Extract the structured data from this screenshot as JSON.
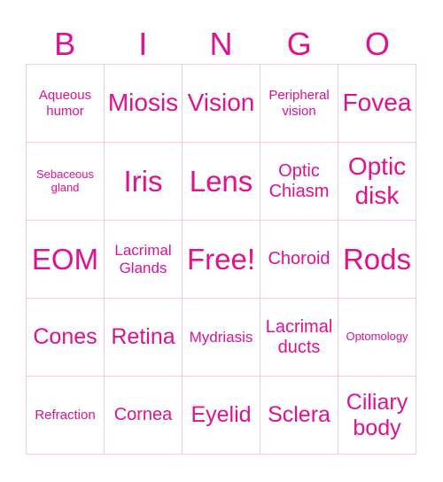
{
  "card": {
    "header": [
      "B",
      "I",
      "N",
      "G",
      "O"
    ],
    "colors": {
      "text": "#e0118f",
      "grid": "#f7c8e3",
      "background": "#ffffff"
    },
    "cells": [
      [
        "Aqueous humor",
        "Miosis",
        "Vision",
        "Peripheral vision",
        "Fovea"
      ],
      [
        "Sebaceous gland",
        "Iris",
        "Lens",
        "Optic Chiasm",
        "Optic disk"
      ],
      [
        "EOM",
        "Lacrimal Glands",
        "Free!",
        "Choroid",
        "Rods"
      ],
      [
        "Cones",
        "Retina",
        "Mydriasis",
        "Lacrimal ducts",
        "Optomology"
      ],
      [
        "Refraction",
        "Cornea",
        "Eyelid",
        "Sclera",
        "Ciliary body"
      ]
    ]
  }
}
